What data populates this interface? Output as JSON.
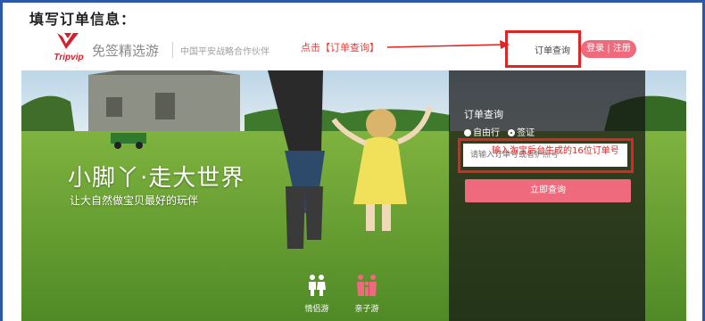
{
  "page": {
    "heading": "填写订单信息："
  },
  "header": {
    "logo_text": "Tripvip",
    "brand_name": "免签精选游",
    "tagline": "中国平安战略合作伙伴",
    "order_link": "订单查询",
    "login_label": "登录 | 注册",
    "hint": "点击【订单查询】"
  },
  "hero": {
    "slogan": "小脚丫·走大世界",
    "sub_slogan": "让大自然做宝贝最好的玩伴"
  },
  "order_panel": {
    "title": "订单查询",
    "radio_options": [
      {
        "label": "自由行",
        "checked": false
      },
      {
        "label": "签证",
        "checked": true
      }
    ],
    "input_placeholder": "请输入订单号或者护照号",
    "annotation": "输入淘宝后台生成的16位订单号",
    "button_label": "立即查询"
  },
  "categories": [
    {
      "label": "情侣游",
      "icon": "couple-icon"
    },
    {
      "label": "亲子游",
      "icon": "family-icon"
    }
  ],
  "colors": {
    "accent_pink": "#ee6a7c",
    "annotation_red": "#e02424",
    "frame_blue": "#2d57a8",
    "logo_red": "#d4202e"
  }
}
